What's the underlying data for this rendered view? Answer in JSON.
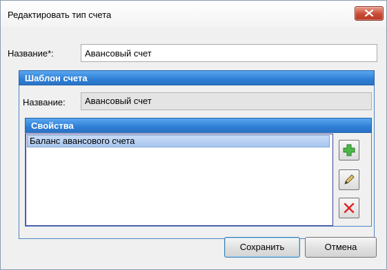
{
  "window": {
    "title": "Редактировать тип счета"
  },
  "form": {
    "name_label": "Название*:",
    "name_value": "Авансовый счет"
  },
  "template_panel": {
    "header": "Шаблон счета",
    "name_label": "Название:",
    "name_value": "Авансовый счет"
  },
  "properties_panel": {
    "header": "Свойства",
    "items": [
      "Баланс авансового счета"
    ],
    "selected_index": 0
  },
  "buttons": {
    "save_label": "Сохранить",
    "cancel_label": "Отмена"
  },
  "icons": {
    "add": "plus-icon",
    "edit": "pencil-icon",
    "delete": "red-x-icon",
    "close": "close-icon"
  },
  "colors": {
    "panel_header": "#2f7fd6",
    "close_button": "#c84b35",
    "selection": "#a9c7ef"
  }
}
